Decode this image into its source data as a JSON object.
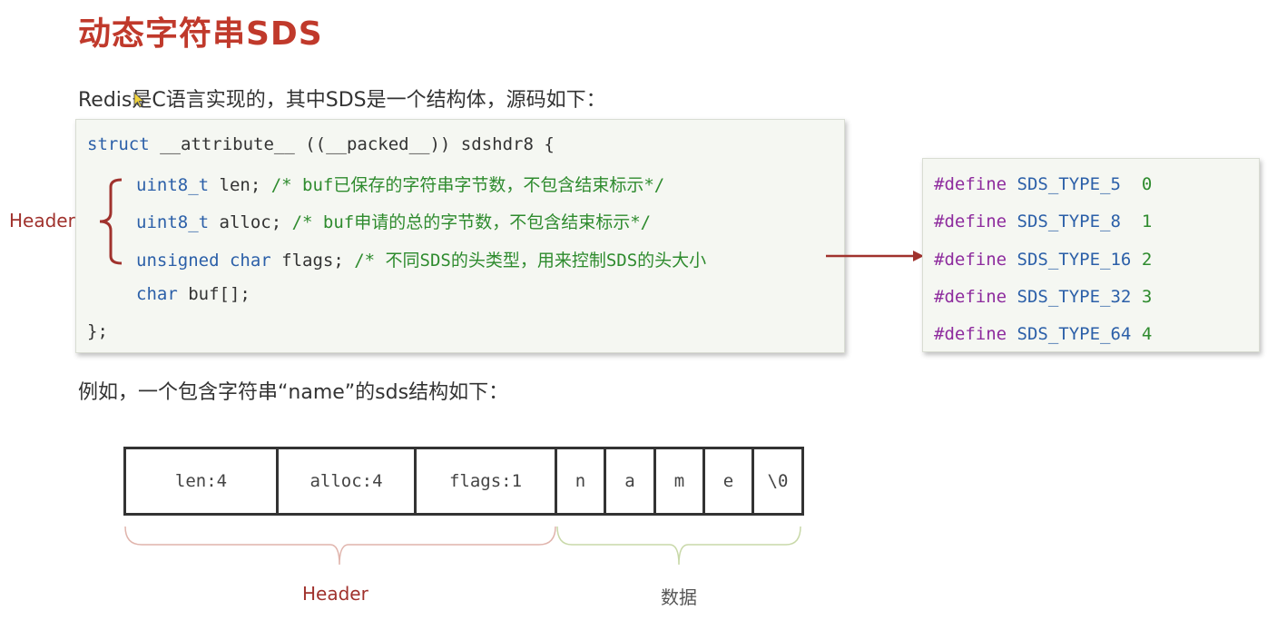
{
  "title": "动态字符串SDS",
  "intro": "Redis是C语言实现的，其中SDS是一个结构体，源码如下：",
  "code": {
    "line1": {
      "kw1": "struct",
      "rest": " __attribute__ ((__packed__)) sdshdr8 {"
    },
    "line2": {
      "kw": "uint8_t",
      "rest": " len; ",
      "comment": "/* buf已保存的字符串字节数，不包含结束标示*/"
    },
    "line3": {
      "kw": "uint8_t",
      "rest": " alloc; ",
      "comment": "/* buf申请的总的字节数，不包含结束标示*/"
    },
    "line4": {
      "kw": "unsigned char",
      "rest": " flags; ",
      "comment": "/* 不同SDS的头类型，用来控制SDS的头大小"
    },
    "line5": {
      "kw": "char",
      "rest": " buf[];"
    },
    "line6": "};"
  },
  "header_label": "Header",
  "defines": [
    {
      "kw": "#define",
      "name": "SDS_TYPE_5 ",
      "val": "0"
    },
    {
      "kw": "#define",
      "name": "SDS_TYPE_8 ",
      "val": "1"
    },
    {
      "kw": "#define",
      "name": "SDS_TYPE_16",
      "val": "2"
    },
    {
      "kw": "#define",
      "name": "SDS_TYPE_32",
      "val": "3"
    },
    {
      "kw": "#define",
      "name": "SDS_TYPE_64",
      "val": "4"
    }
  ],
  "example": "例如，一个包含字符串“name”的sds结构如下：",
  "cells": [
    "len:4",
    "alloc:4",
    "flags:1",
    "n",
    "a",
    "m",
    "e",
    "\\0"
  ],
  "bottom_labels": {
    "header": "Header",
    "data": "数据"
  },
  "colors": {
    "title": "#c0392b",
    "header": "#a0322d",
    "data_brace": "#c8d8a8"
  }
}
